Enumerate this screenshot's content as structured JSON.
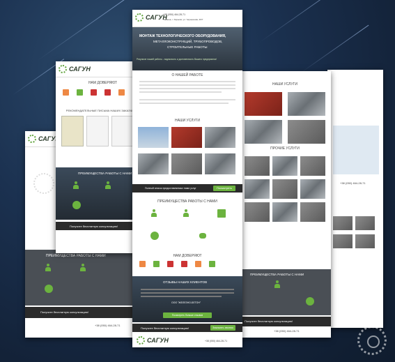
{
  "brand": {
    "name": "САГУН",
    "accent": "#6cb33f",
    "dark": "#4a4f55"
  },
  "center": {
    "phone": "+38 (050) 464-28-71",
    "address": "Украина, г. Харьков, ул. Чернышева, 20/7",
    "hero_lines": [
      "МОНТАЖ ТЕХНОЛОГИЧЕСКОГО ОБОРУДОВАНИЯ,",
      "МЕТАЛЛОКОНСТРУКЦИЙ, ТРУБОПРОВОДОВ,",
      "СТРОИТЕЛЬНЫЕ РАБОТЫ"
    ],
    "hero_sub": "Результат нашей работы - надежность и долговечность Вашего предприятия!",
    "about_title": "О НАШЕЙ РАБОТЕ",
    "services_title": "НАШИ УСЛУГИ",
    "full_list": "Полный список предоставляемых нами услуг",
    "full_list_btn": "Посмотреть",
    "advantages_title": "ПРЕИМУЩЕСТВА РАБОТЫ С НАМИ",
    "trust_title": "НАМ ДОВЕРЯЮТ",
    "reviews_title": "ОТЗЫВЫ НАШИХ КЛИЕНТОВ",
    "review_name": "ООО \"ЖЕЛЕЗНО-БЕТОН\"",
    "reviews_btn": "Посмотреть больше отзывов",
    "consult": "Получите бесплатную консультацию!",
    "consult_btn": "Заказать звонок",
    "footer_phone": "+38 (050) 464-28-71",
    "footer_logo": "САГУН"
  },
  "left_mid": {
    "trust_title": "НАМ ДОВЕРЯЮТ",
    "letters_title": "РЕКОМЕНДАТЕЛЬНЫЕ ПИСЬМА НАШИХ ЗАКАЗЧИКОВ",
    "advantages_title": "ПРЕИМУЩЕСТВА РАБОТЫ С НАМИ",
    "consult": "Получите бесплатную консультацию!"
  },
  "left_back": {
    "advantages_title": "ПРЕИМУЩЕСТВА РАБОТЫ С НАМИ",
    "consult": "Получите бесплатную консультацию!",
    "phone": "+38 (050) 464-28-71"
  },
  "right_mid": {
    "services_title": "НАШИ УСЛУГИ",
    "other_title": "ПРОЧИЕ УСЛУГИ",
    "advantages_title": "ПРЕИМУЩЕСТВА РАБОТЫ С НАМИ",
    "consult": "Получите бесплатную консультацию!",
    "phone": "+38 (050) 464-28-71"
  },
  "right_back": {
    "phone": "+38 (050) 464-28-71"
  }
}
